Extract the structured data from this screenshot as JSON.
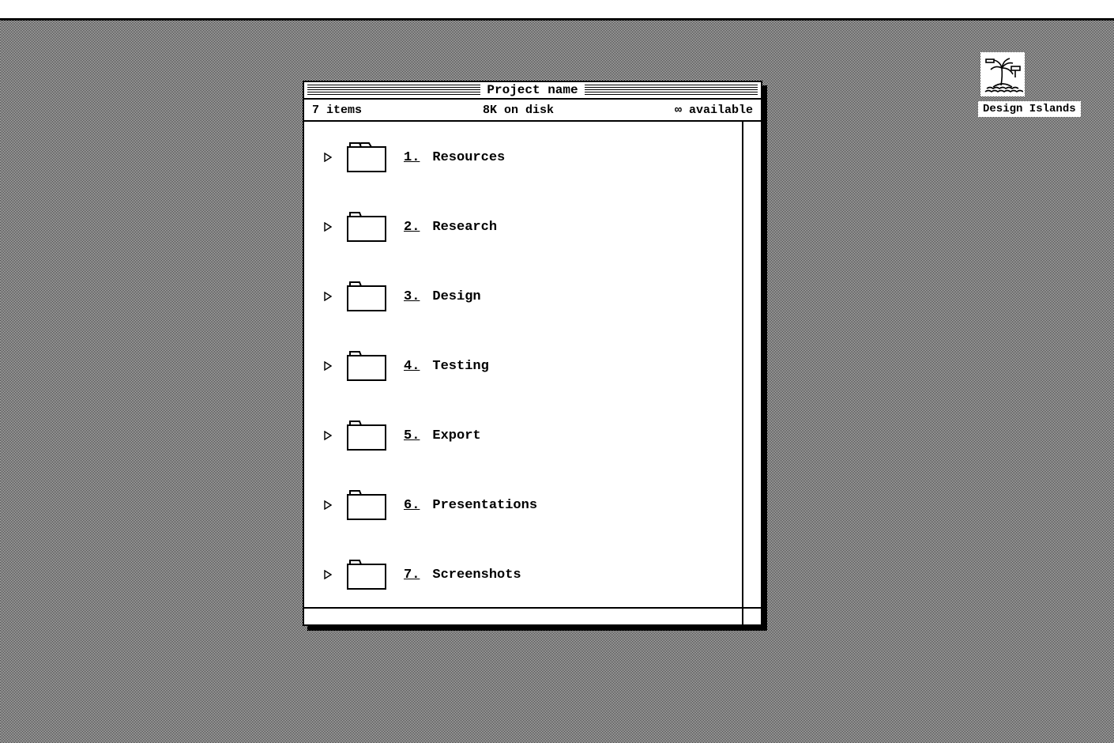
{
  "desktop": {
    "disk_label": "Design Islands"
  },
  "window": {
    "title": "Project name",
    "info": {
      "items": "7 items",
      "disk": "8K on disk",
      "available": "∞ available"
    },
    "folders": [
      {
        "num": "1.",
        "label": "Resources"
      },
      {
        "num": "2.",
        "label": "Research"
      },
      {
        "num": "3.",
        "label": "Design"
      },
      {
        "num": "4.",
        "label": "Testing"
      },
      {
        "num": "5.",
        "label": "Export"
      },
      {
        "num": "6.",
        "label": "Presentations"
      },
      {
        "num": "7.",
        "label": "Screenshots"
      }
    ]
  }
}
